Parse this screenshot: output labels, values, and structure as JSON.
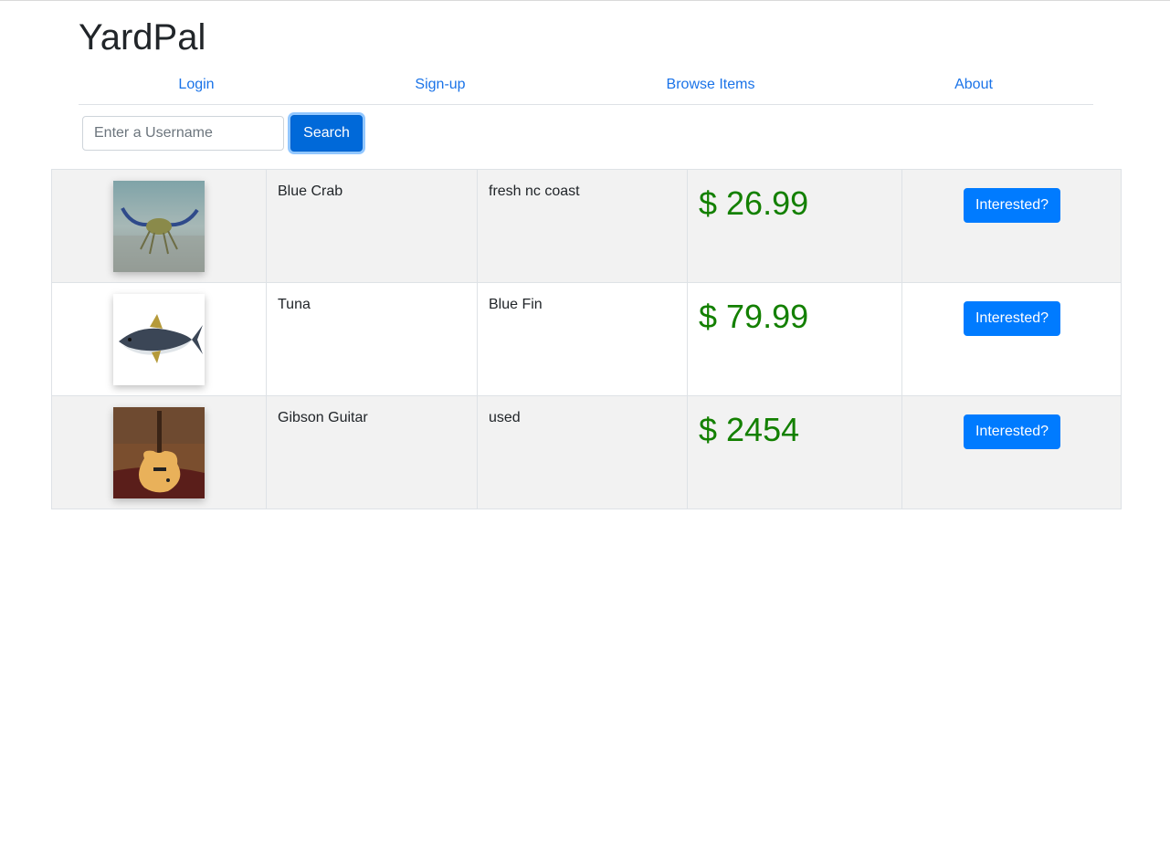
{
  "brand": "YardPal",
  "nav": [
    {
      "label": "Login"
    },
    {
      "label": "Sign-up"
    },
    {
      "label": "Browse Items"
    },
    {
      "label": "About"
    }
  ],
  "search": {
    "placeholder": "Enter a Username",
    "value": "",
    "button_label": "Search"
  },
  "items": [
    {
      "name": "Blue Crab",
      "description": "fresh nc coast",
      "price": "$ 26.99",
      "action_label": "Interested?",
      "image": "blue-crab-photo"
    },
    {
      "name": "Tuna",
      "description": "Blue Fin",
      "price": "$ 79.99",
      "action_label": "Interested?",
      "image": "tuna-photo"
    },
    {
      "name": "Gibson Guitar",
      "description": "used",
      "price": "$ 2454",
      "action_label": "Interested?",
      "image": "guitar-photo"
    }
  ],
  "colors": {
    "link": "#1a73e8",
    "primary_button": "#007bff",
    "price": "#138000",
    "stripe": "#f2f2f2"
  }
}
